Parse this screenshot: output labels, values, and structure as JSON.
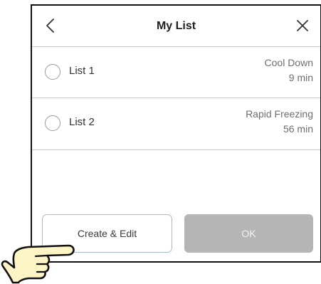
{
  "dialog": {
    "title": "My List",
    "back_icon": "chevron-left-icon",
    "close_icon": "close-icon"
  },
  "lists": [
    {
      "label": "List 1",
      "mode": "Cool Down",
      "duration": "9 min",
      "selected": false
    },
    {
      "label": "List 2",
      "mode": "Rapid Freezing",
      "duration": "56 min",
      "selected": false
    }
  ],
  "buttons": {
    "create_edit": "Create & Edit",
    "ok": "OK"
  },
  "pointer_icon": "pointing-hand-icon",
  "colors": {
    "ok_button_bg": "#b5b5b5",
    "create_button_border": "#a7bcc8",
    "divider": "#c8c8c8"
  }
}
